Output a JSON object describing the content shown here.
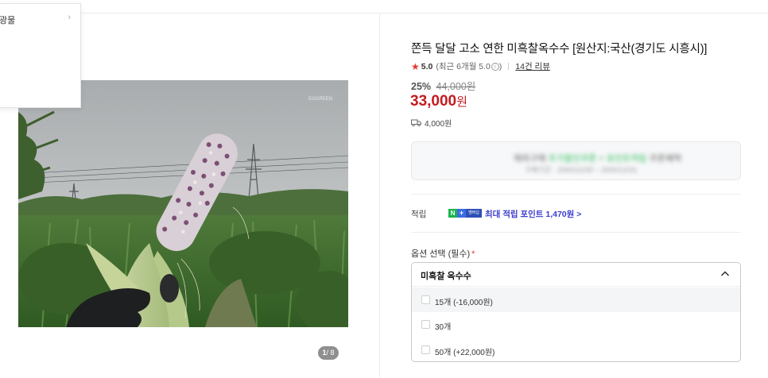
{
  "menu": {
    "item_label": "광물"
  },
  "gallery": {
    "pager_current": "1",
    "pager_total": "/ 8",
    "watermark": "EGGREEN"
  },
  "product": {
    "title": "쫀득 달달 고소 연한 미흑찰옥수수 [원산지:국산(경기도 시흥시)]",
    "rating": "5.0",
    "rating_detail": "(최근 6개월 5.0",
    "reviews": "14건 리뷰",
    "discount": "25%",
    "original_price": "44,000원",
    "price": "33,000",
    "price_unit": "원",
    "shipping": "4,000원"
  },
  "blurred_banner": {
    "line1_a": "해외구매",
    "line1_b": "추가할인쿠폰 + 포인트적립",
    "line1_c": "쿠폰혜택",
    "line2": "구매기간 · 2000/12/30 ~ 2000/12/31"
  },
  "points": {
    "label": "적립",
    "npay_n": "N",
    "npay_plus": "+",
    "npay_member": "멤버십",
    "text": "최대 적립 포인트 1,470원 >"
  },
  "options": {
    "label": "옵션 선택 (필수)",
    "required_mark": "*",
    "selected": "미흑찰 옥수수",
    "items": [
      {
        "label": "15개 (-16,000원)"
      },
      {
        "label": "30개"
      },
      {
        "label": "50개 (+22,000원)"
      }
    ]
  },
  "colors": {
    "price_red": "#c41a1f",
    "point_blue": "#3c3ccf",
    "star_red": "#e8362c",
    "npay_green": "#19b34a"
  }
}
